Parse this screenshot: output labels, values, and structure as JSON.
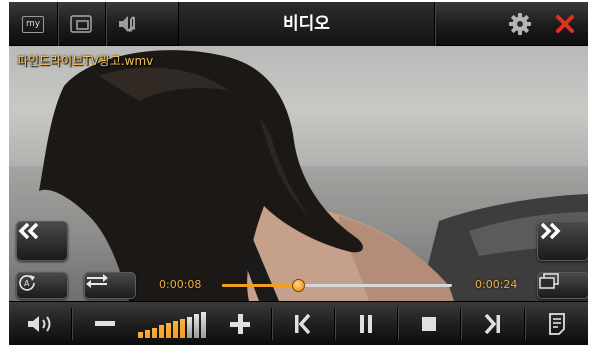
{
  "header": {
    "title": "비디오",
    "my_label": "my"
  },
  "video": {
    "filename": "파인드라이브TV광고.wmv"
  },
  "playback": {
    "elapsed": "0:00:08",
    "total": "0:00:24",
    "progress_fraction": 0.33
  },
  "volume": {
    "level_fraction": 0.7,
    "levels_total": 10
  },
  "icons": {
    "top": [
      "my-icon",
      "window-icon",
      "speaker-music-icon",
      "gear-icon",
      "close-icon"
    ],
    "overlay": [
      "rewind-icon",
      "fast-forward-icon",
      "repeat-icon",
      "shuffle-icon",
      "screen-mode-icon"
    ],
    "bottom": [
      "volume-icon",
      "minus-icon",
      "plus-icon",
      "previous-icon",
      "pause-icon",
      "stop-icon",
      "next-icon",
      "playlist-icon"
    ]
  },
  "colors": {
    "accent": "#f0a020",
    "time_text": "#f0b040",
    "filename_text": "#f2c35a",
    "close": "#e03020"
  }
}
